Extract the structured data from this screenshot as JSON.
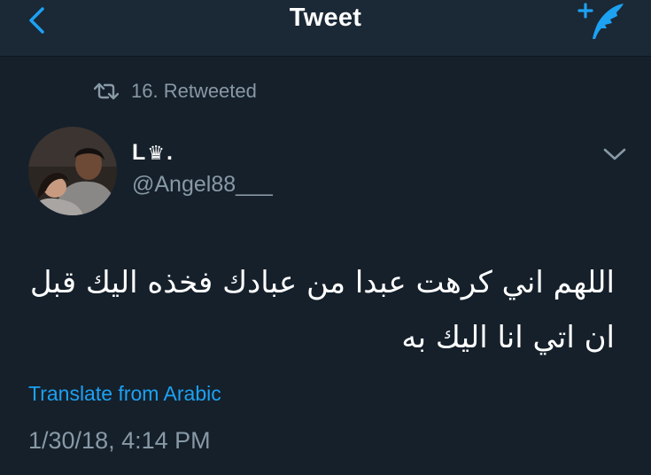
{
  "nav": {
    "title": "Tweet",
    "back_icon": "chevron-left-icon",
    "compose_icon": "compose-tweet-icon"
  },
  "colors": {
    "background": "#15202b",
    "nav_background": "#1b2836",
    "accent": "#1da1f2",
    "secondary_text": "#8899a6"
  },
  "retweet": {
    "icon": "retweet-icon",
    "text": "16. Retweeted"
  },
  "tweet": {
    "author_name_prefix": "L",
    "author_name_glyph": "♛",
    "author_name_suffix": ".",
    "handle": "@Angel88___",
    "menu_icon": "chevron-down-icon",
    "text": "اللهم اني كرهت عبدا من عبادك فخذه اليك قبل ان اتي انا اليك به",
    "translate_label": "Translate from Arabic",
    "timestamp": "1/30/18, 4:14 PM"
  }
}
